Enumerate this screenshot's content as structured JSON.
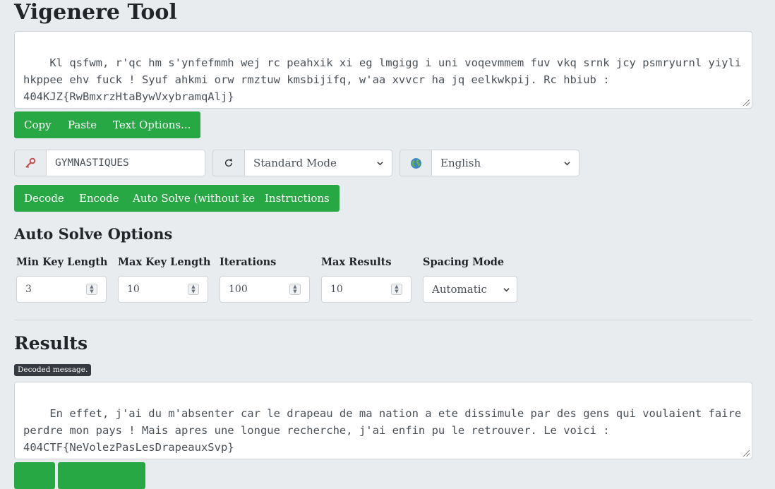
{
  "app": {
    "title": "Vigenere Tool"
  },
  "input": {
    "text": "Kl qsfwm, r'qc hm s'ynfefmmh wej rc peahxik xi eg lmgigg i uni voqevmmem fuv vkq srnk jcy psmryurnl yiyli hkppee ehv fuck ! Syuf ahkmi orw rmztuw kmsbijifq, w'aa xvvcr ha jq eelkwkpij. Rc hbiub : 404KJZ{RwBmxrzHtaBywVxybramqAlj}"
  },
  "text_buttons": {
    "copy": "Copy",
    "paste": "Paste",
    "options": "Text Options..."
  },
  "key": {
    "icon": "key-icon",
    "value": "GYMNASTIQUES"
  },
  "mode": {
    "icon": "refresh-icon",
    "selected": "Standard Mode"
  },
  "language": {
    "icon": "globe-icon",
    "selected": "English"
  },
  "action_buttons": {
    "decode": "Decode",
    "encode": "Encode",
    "auto_solve": "Auto Solve (without key)",
    "instructions": "Instructions"
  },
  "auto_solve": {
    "heading": "Auto Solve Options",
    "min_key_length": {
      "label": "Min Key Length",
      "value": "3"
    },
    "max_key_length": {
      "label": "Max Key Length",
      "value": "10"
    },
    "iterations": {
      "label": "Iterations",
      "value": "100"
    },
    "max_results": {
      "label": "Max Results",
      "value": "10"
    },
    "spacing_mode": {
      "label": "Spacing Mode",
      "selected": "Automatic"
    }
  },
  "results": {
    "heading": "Results",
    "badge": "Decoded message.",
    "text": "En effet, j'ai du m'absenter car le drapeau de ma nation a ete dissimule par des gens qui voulaient faire perdre mon pays ! Mais apres une longue recherche, j'ai enfin pu le retrouver. Le voici : 404CTF{NeVolezPasLesDrapeauxSvp}"
  },
  "colors": {
    "accent": "#28a745",
    "background": "#e9ecef",
    "badge": "#343a40"
  }
}
